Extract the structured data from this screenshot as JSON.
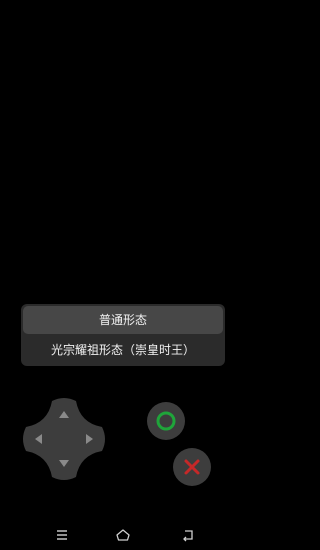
{
  "menu": {
    "items": [
      {
        "label": "普通形态",
        "highlighted": true
      },
      {
        "label": "光宗耀祖形态（崇皇时王）",
        "highlighted": false
      }
    ]
  },
  "controls": {
    "dpad": {
      "icon": "dpad-icon"
    },
    "circle_button": {
      "icon": "circle-icon",
      "color": "#1fa53a"
    },
    "cross_button": {
      "icon": "cross-icon",
      "color": "#c62828"
    }
  },
  "navbar": {
    "menu_icon": "menu-icon",
    "home_icon": "home-icon",
    "back_icon": "back-icon"
  }
}
